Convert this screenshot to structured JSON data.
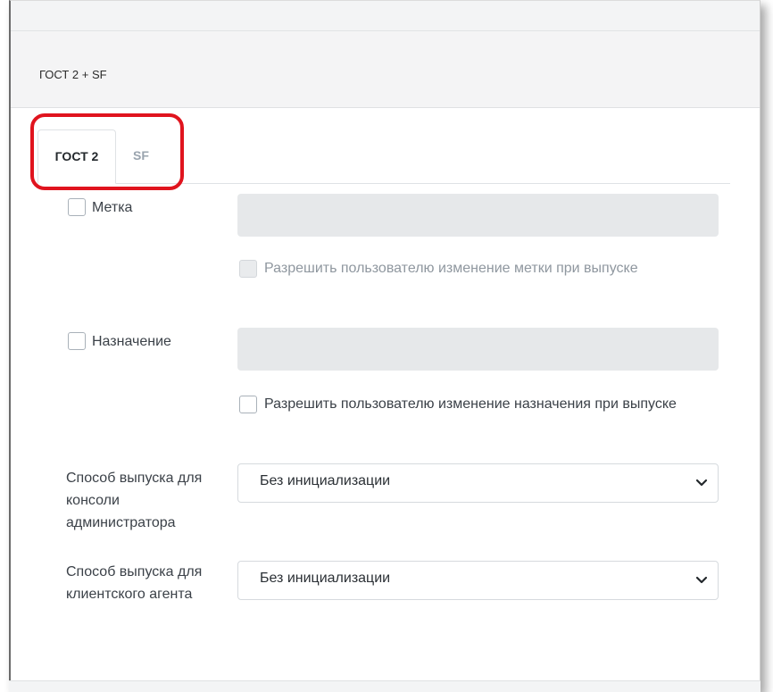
{
  "header": {
    "title": "ГОСТ 2 + SF"
  },
  "tabs": [
    {
      "label": "ГОСТ 2",
      "active": true
    },
    {
      "label": "SF",
      "active": false
    }
  ],
  "form": {
    "label_field": {
      "checkbox_label": "Метка",
      "checked": false,
      "value": "",
      "allow_change_label": "Разрешить пользователю изменение метки при выпуске",
      "allow_change_disabled": true
    },
    "purpose_field": {
      "checkbox_label": "Назначение",
      "checked": false,
      "value": "",
      "allow_change_label": "Разрешить пользователю изменение назначения при выпуске",
      "allow_change_disabled": false
    },
    "admin_console": {
      "label": "Способ выпуска для консоли администратора",
      "selected": "Без инициализации"
    },
    "client_agent": {
      "label": "Способ выпуска для клиентского агента",
      "selected": "Без инициализации"
    }
  },
  "colors": {
    "highlight": "#e0141e",
    "tab_inactive": "#9aa4ae",
    "input_disabled_bg": "#e6e8ea"
  }
}
